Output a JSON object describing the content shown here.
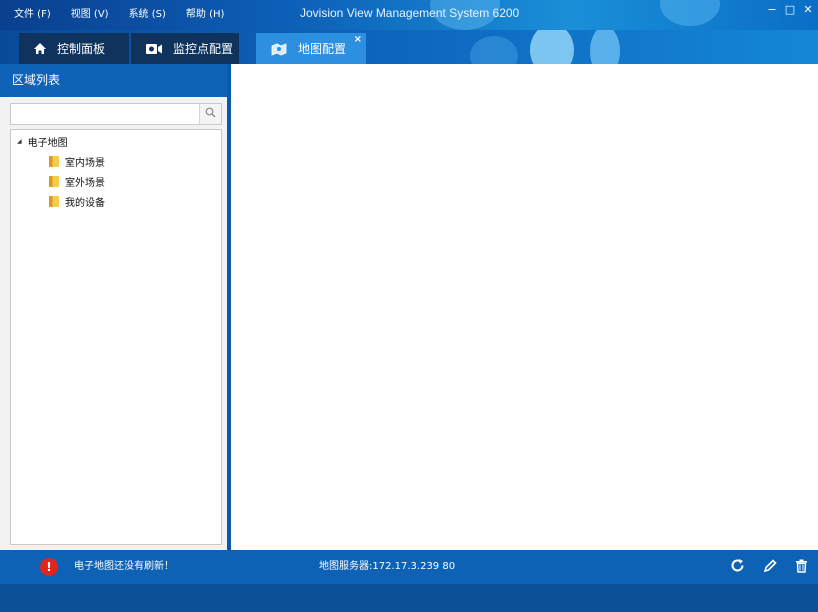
{
  "menu": {
    "items": [
      {
        "label": "文件 (F)"
      },
      {
        "label": "视图 (V)"
      },
      {
        "label": "系统 (S)"
      },
      {
        "label": "帮助 (H)"
      }
    ]
  },
  "app_title": "Jovision View Management System 6200",
  "window": {
    "minimize": "−",
    "maximize": "□",
    "close": "✕"
  },
  "tabs": [
    {
      "label": "控制面板",
      "icon": "home-icon"
    },
    {
      "label": "监控点配置",
      "icon": "camera-icon"
    },
    {
      "label": "地图配置",
      "icon": "map-icon",
      "active": true,
      "close": "×"
    }
  ],
  "sidebar": {
    "title": "区域列表",
    "search": {
      "value": "",
      "placeholder": ""
    },
    "tree": {
      "root": {
        "label": "电子地图",
        "expander": "◢"
      },
      "children": [
        {
          "label": "室内场景"
        },
        {
          "label": "室外场景"
        },
        {
          "label": "我的设备"
        }
      ]
    }
  },
  "status": {
    "alert_icon": "!",
    "message": "电子地图还没有刷新！",
    "server": "地图服务器:172.17.3.239 80"
  },
  "colors": {
    "accent": "#0d62b6",
    "active_tab": "#2c8fe0",
    "alert": "#e0251d"
  }
}
